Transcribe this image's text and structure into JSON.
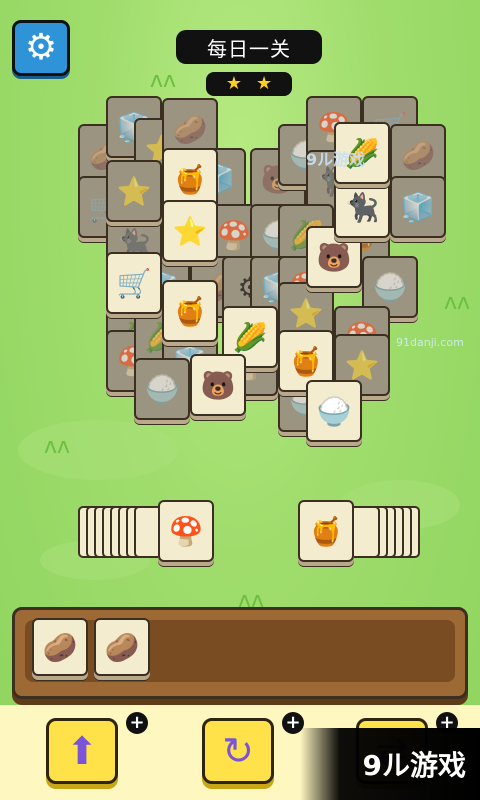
{
  "header": {
    "title": "每日一关",
    "stars_count": 2
  },
  "icons": {
    "settings": "gear-icon",
    "undo": "undo-arrow-icon",
    "refresh": "refresh-icon",
    "shuffle": "shuffle-icon",
    "plus": "plus-icon"
  },
  "board_tiles": [
    {
      "symbol": "🍯",
      "state": "active"
    },
    {
      "symbol": "⭐",
      "state": "active"
    },
    {
      "symbol": "🐻",
      "state": "active"
    },
    {
      "symbol": "🍯",
      "state": "active"
    },
    {
      "symbol": "🌽",
      "state": "active"
    },
    {
      "symbol": "🍯",
      "state": "active"
    },
    {
      "symbol": "🐻",
      "state": "active"
    },
    {
      "symbol": "🍚",
      "state": "active"
    },
    {
      "symbol": "🛒",
      "state": "active"
    },
    {
      "symbol": "🐈‍⬛",
      "state": "active"
    },
    {
      "symbol": "🌽",
      "state": "active"
    }
  ],
  "stacks": {
    "left_top": {
      "symbol": "🍄"
    },
    "right_top": {
      "symbol": "🍯"
    }
  },
  "tray": {
    "items": [
      "🥔",
      "🥔"
    ]
  },
  "buttons": {
    "undo_plus": "+",
    "refresh_plus": "+",
    "shuffle_plus": "+"
  },
  "watermark": {
    "bottom": "9ル游戏",
    "site": "91danji.com",
    "top": "9ル游戏"
  },
  "colors": {
    "settings_bg": "#2f93d8",
    "power_button": "#ffe14a",
    "tray_wood": "#9d6a35"
  }
}
